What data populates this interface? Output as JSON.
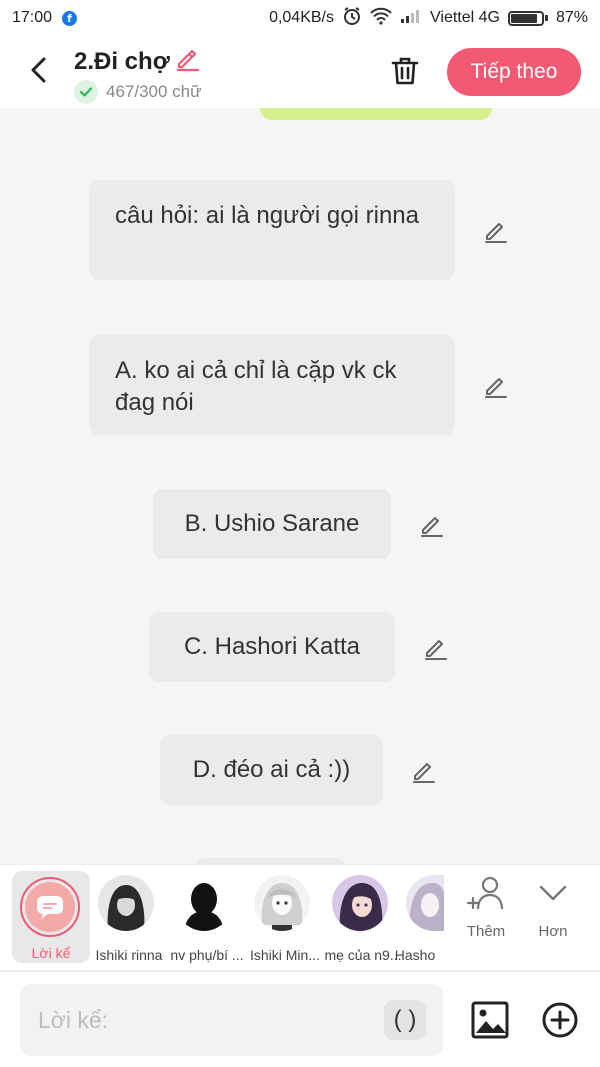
{
  "status_bar": {
    "time": "17:00",
    "fb_letter": "f",
    "net_speed": "0,04KB/s",
    "carrier": "Viettel 4G",
    "battery": "87%",
    "battery_level": 0.87
  },
  "header": {
    "title": "2.Đi chợ",
    "word_count": "467/300 chữ",
    "next_label": "Tiếp theo"
  },
  "messages": [
    {
      "text": "câu hỏi: ai là người gọi rinna"
    },
    {
      "text": "A. ko ai cả chỉ là cặp vk ck đag nói"
    },
    {
      "text": "B. Ushio Sarane"
    },
    {
      "text": "C. Hashori Katta"
    },
    {
      "text": "D. đéo ai cả :))"
    }
  ],
  "character_bar": {
    "narrator_label": "Lời kể",
    "characters": [
      {
        "name": "Ishiki rinna"
      },
      {
        "name": "nv phụ/bí ..."
      },
      {
        "name": "Ishiki Min..."
      },
      {
        "name": "mẹ của n9..."
      },
      {
        "name": "Hasho"
      }
    ],
    "add_label": "Thêm",
    "more_label": "Hơn"
  },
  "input": {
    "placeholder": "Lời kể:",
    "paren_label": "( )"
  },
  "colors": {
    "accent": "#f25a73",
    "bubble": "#ebebeb",
    "green_bubble": "#d5f08e"
  }
}
